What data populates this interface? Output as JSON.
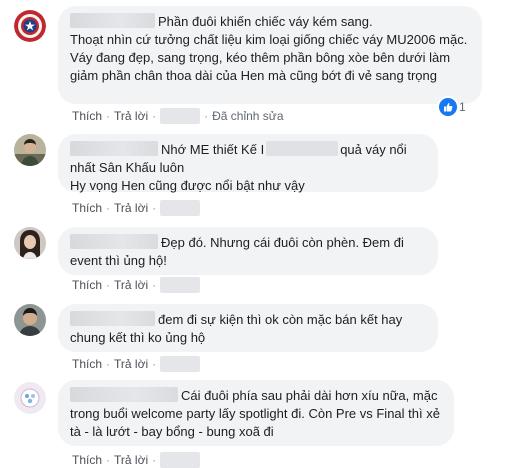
{
  "actions": {
    "like": "Thích",
    "reply": "Trả lời",
    "sep": "·",
    "edited": "Đã chỉnh sửa"
  },
  "comments": [
    {
      "avatar_icon": "captain-america-shield-icon",
      "lines": [
        "Phần đuôi khiến chiếc váy kém sang.",
        "Thoạt nhìn cứ tưởng chất liệu kim loại giống chiếc váy MU2006 mặc.",
        "Váy đang đẹp, sang trọng, kéo thêm phần bông xòe bên dưới làm giảm phần chân thoa dài của Hen mà cũng bớt đi vẻ sang trọng"
      ],
      "reaction_icon": "like-icon",
      "reaction_count": "1",
      "edited": true
    },
    {
      "avatar_icon": "user-photo-icon",
      "text_a": "Nhớ ME thiết Kế I",
      "text_b": "quả váy nổi nhất Sân Khấu luôn",
      "line2": "Hy vọng Hen cũng được nổi bật như vậy"
    },
    {
      "avatar_icon": "user-photo-icon",
      "text": "Đẹp đó. Nhưng cái đuôi còn phèn. Đem đi event thì ủng hộ!"
    },
    {
      "avatar_icon": "user-photo-icon",
      "text": "đem đi sự kiện thì ok còn mặc bán kết hay chung kết thì ko ủng hộ"
    },
    {
      "avatar_icon": "default-avatar-icon",
      "text": "Cái đuôi phía sau phải dài hơn xíu nữa, mặc trong buổi welcome party lấy spotlight đi. Còn Pre vs Final thì xẻ tà - là lướt - bay bổng - bung xoã đi"
    }
  ]
}
